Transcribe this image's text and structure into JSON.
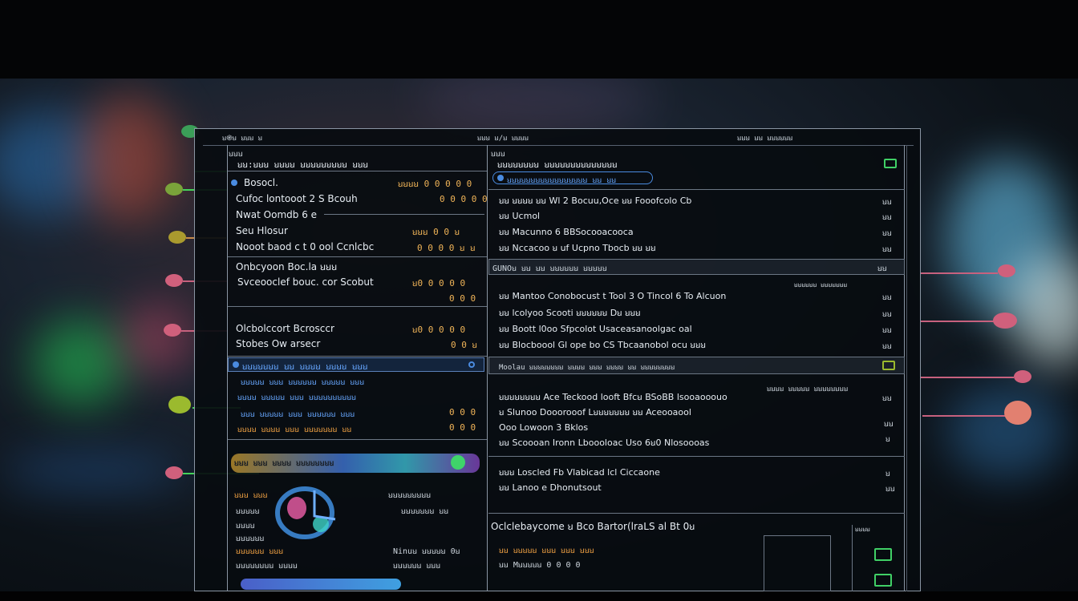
{
  "window": {
    "title_left": "ꞟ֎ꞟ ꞟꞟꞟ ꞟ",
    "title_mid": "ꞟꞟꞟ ꞟ/ꞟ ꞟꞟꞟꞟ",
    "title_right": "ꞟꞟꞟ ꞟꞟ ꞟꞟꞟꞟꞟꞟ"
  },
  "left": {
    "header": "ꞟꞟꞟ",
    "top_line": "ꞟꞟ꞉ꞟꞟꞟ ꞟꞟꞟꞟ ꞟꞟꞟꞟꞟꞟꞟꞟꞟ ꞟꞟꞟ",
    "group1": [
      {
        "label": "Bosocl.",
        "value": "ꞟꞟꞟꞟ 0 0 0 0 0"
      },
      {
        "label": "Cufoc lontooot  2 S Bcouh",
        "value": "0 0 0 0 0"
      },
      {
        "label": "Nwat Oomdb 6 e",
        "value": ""
      },
      {
        "label": "Seu Hlosur",
        "value": "ꞟꞟꞟ 0 0 ꞟ"
      },
      {
        "label": "Nooot baod c t 0 ool Ccnlcbc",
        "value": "0 0 0 0 ꞟ ꞟ"
      }
    ],
    "group2": [
      {
        "label": "Onbcyoon Boc.la ꞟꞟꞟ",
        "value": ""
      },
      {
        "label": "Svceooclef bouc. cor Scobut",
        "value": "ꞟ0 0 0 0 0"
      },
      {
        "label": "",
        "value": "0 0 0"
      }
    ],
    "group3": [
      {
        "label": "Olcbolccort Bcrosccr",
        "value": "ꞟ0 0 0 0 0"
      },
      {
        "label": "Stobes Ow arsecr",
        "value": "0 0 ꞟ"
      }
    ],
    "blue_header": "ꞟꞟꞟꞟꞟꞟꞟ ꞟꞟ ꞟꞟꞟꞟ ꞟꞟꞟꞟ ꞟꞟꞟ",
    "blue_rows": [
      "ꞟꞟꞟꞟꞟ ꞟꞟꞟ ꞟꞟꞟꞟꞟꞟ ꞟꞟꞟꞟꞟ ꞟꞟꞟ",
      "ꞟꞟꞟꞟ ꞟꞟꞟꞟꞟ ꞟꞟꞟ ꞟꞟꞟꞟꞟꞟꞟꞟꞟꞟ",
      "ꞟꞟꞟ ꞟꞟꞟꞟꞟ ꞟꞟꞟ ꞟꞟꞟꞟꞟꞟ ꞟꞟꞟ",
      "ꞟꞟꞟꞟ ꞟꞟꞟꞟ ꞟꞟꞟ ꞟꞟꞟꞟꞟꞟꞟ ꞟꞟ"
    ],
    "blue_values": [
      "",
      "",
      "0 0 0",
      "0 0 0"
    ],
    "chart_header": "ꞟꞟꞟ ꞟꞟꞟ ꞟꞟꞟꞟ ꞟꞟꞟꞟꞟꞟꞟꞟ",
    "chart_rows_left": [
      "ꞟꞟꞟ ꞟꞟꞟ",
      "ꞟꞟꞟꞟꞟ",
      "ꞟꞟꞟꞟ",
      "ꞟꞟꞟꞟꞟꞟ",
      "ꞟꞟꞟꞟꞟꞟ ꞟꞟꞟ",
      "ꞟꞟꞟꞟꞟꞟꞟꞟ ꞟꞟꞟꞟ"
    ],
    "chart_rows_right": [
      "ꞟꞟꞟꞟꞟꞟꞟꞟꞟ",
      "ꞟꞟꞟꞟꞟꞟꞟ ꞟꞟ",
      "Ninuꞟ ꞟꞟꞟꞟꞟ 0ꞟ",
      "ꞟꞟꞟꞟꞟꞟ ꞟꞟꞟ"
    ]
  },
  "right": {
    "header": "ꞟꞟꞟ",
    "title_row": "ꞟꞟꞟꞟꞟꞟꞟꞟ ꞟꞟꞟꞟꞟꞟꞟꞟꞟꞟꞟꞟꞟꞟ",
    "sub_row": "ꞟꞟꞟꞟꞟꞟꞟꞟꞟꞟꞟꞟꞟꞟꞟꞟꞟ ꞟꞟ ꞟꞟ",
    "group1": [
      {
        "label": "ꞟꞟ ꞟꞟꞟꞟ ꞟꞟ Wl 2 Bocuu,Oce ꞟꞟ Fooofcolo Cb",
        "value": "ꞟꞟ"
      },
      {
        "label": "ꞟꞟ Ucmol",
        "value": "ꞟꞟ"
      },
      {
        "label": "ꞟꞟ Macunno  6 BBSocooacooca",
        "value": "ꞟꞟ"
      },
      {
        "label": "ꞟꞟ Nccacoo ꞟ uf Ucpno Tbocb ꞟꞟ ꞟꞟ",
        "value": "ꞟꞟ"
      }
    ],
    "section2_header": "GUNOꞟ ꞟꞟ ꞟꞟ ꞟꞟꞟꞟꞟꞟ ꞟꞟꞟꞟꞟ",
    "section2_title": "ꞟꞟꞟꞟꞟꞟ ꞟꞟꞟꞟꞟꞟꞟ",
    "group2": [
      {
        "label": "ꞟꞟ Mantoo Conobocust t Tool 3 O Tincol 6 To Alcuon",
        "value": "ꞟꞟ"
      },
      {
        "label": "ꞟꞟ lcolyoo Scooti ꞟꞟꞟꞟꞟꞟ Dꞟ ꞟꞟꞟ",
        "value": "ꞟꞟ"
      },
      {
        "label": "ꞟꞟ Boott l0oo Sfpcolot Usaceasanoolgac oal",
        "value": "ꞟꞟ"
      },
      {
        "label": "ꞟꞟ Blocboool Gl ope bo CS Tbcaanobol ocu ꞟꞟꞟ",
        "value": "ꞟꞟ"
      }
    ],
    "section3_header": "Moolau ꞟꞟꞟꞟꞟꞟꞟꞟ ꞟꞟꞟꞟ ꞟꞟꞟ ꞟꞟꞟꞟ ꞟꞟ ꞟꞟꞟꞟꞟꞟꞟꞟ",
    "section3_tag": "ꞟꞟꞟꞟ ꞟꞟꞟꞟꞟ ꞟꞟꞟꞟꞟꞟꞟꞟ",
    "group3": [
      {
        "label": "ꞟꞟꞟꞟꞟꞟꞟꞟ Ace Teckood looft Bfcꞟ BSoBB lsooaooouo",
        "value": "ꞟꞟ"
      },
      {
        "label": "ꞟ Slunoo Dooorooof Lꞟꞟꞟꞟꞟꞟꞟ ꞟꞟ Aceooaool",
        "value": ""
      },
      {
        "label": "Ooo Lowoon 3 Bklos",
        "value": "ꞟꞟ"
      },
      {
        "label": "ꞟꞟ Scoooan Ironn Lboooloac Uso 6ꞟ0 Nlosoooas",
        "value": "ꞟ"
      }
    ],
    "group4": [
      {
        "label": "ꞟꞟꞟ Loscled Fb Vlabicad lcl Ciccaone",
        "value": "ꞟ"
      },
      {
        "label": "ꞟꞟ Lanoo e Dhonutsout",
        "value": "ꞟꞟ"
      }
    ],
    "section5_title": "Oclclebaycome ꞟ Bco Bartor(lraLS al Bt 0ꞟ",
    "section5_rows": [
      "ꞟꞟ ꞟꞟꞟꞟꞟ ꞟꞟꞟ ꞟꞟꞟ ꞟꞟꞟ",
      "ꞟꞟ Mꞟꞟꞟꞟꞟ 0 0 0 0"
    ],
    "section5_badge": "ꞟꞟꞟꞟ"
  }
}
